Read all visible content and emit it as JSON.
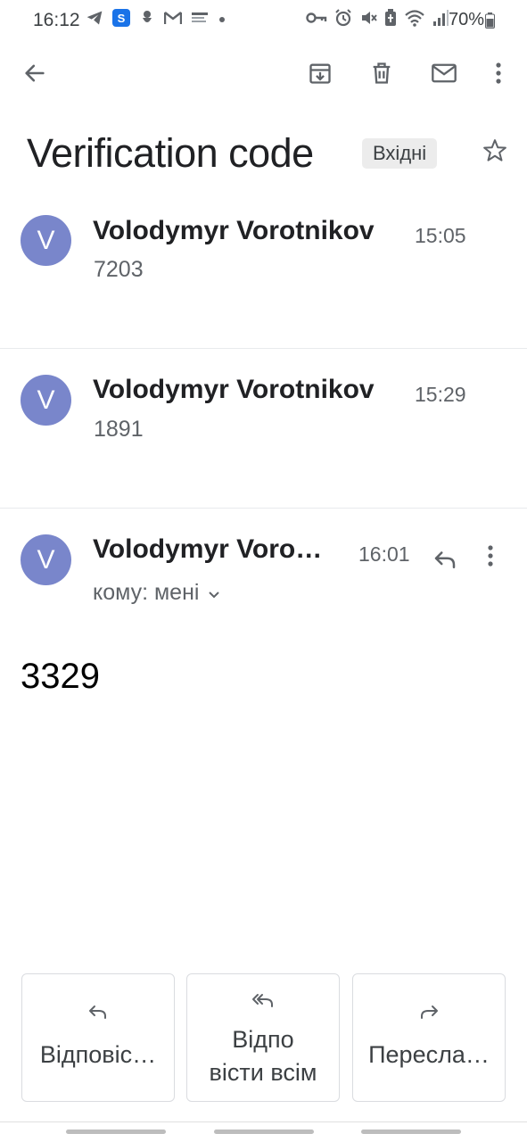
{
  "status_bar": {
    "time": "16:12",
    "battery": "70%",
    "left_icons": [
      "telegram-icon",
      "s-app-icon",
      "squid-icon",
      "gmail-icon",
      "news-icon",
      "dot-icon"
    ],
    "right_icons": [
      "key-icon",
      "alarm-icon",
      "mute-icon",
      "battery-saver-icon",
      "wifi-icon",
      "signal-icon"
    ]
  },
  "toolbar": {
    "icons": [
      "back-arrow-icon",
      "archive-icon",
      "delete-icon",
      "mark-unread-icon",
      "more-vert-icon"
    ]
  },
  "subject": {
    "title": "Verification code",
    "label": "Вхідні"
  },
  "messages": [
    {
      "avatar_letter": "V",
      "sender": "Volodymyr Vorotnikov",
      "time": "15:05",
      "snippet": "7203"
    },
    {
      "avatar_letter": "V",
      "sender": "Volodymyr Vorotnikov",
      "time": "15:29",
      "snippet": "1891"
    },
    {
      "avatar_letter": "V",
      "sender": "Volodymyr Voro…",
      "time": "16:01",
      "to": "кому: мені",
      "body": "3329"
    }
  ],
  "actions": {
    "reply": "Відповіс…",
    "reply_all_line1": "Відпо",
    "reply_all_line2": "вісти всім",
    "forward": "Пересла…"
  },
  "colors": {
    "avatar": "#7986cb",
    "label_chip_bg": "#ececec"
  }
}
